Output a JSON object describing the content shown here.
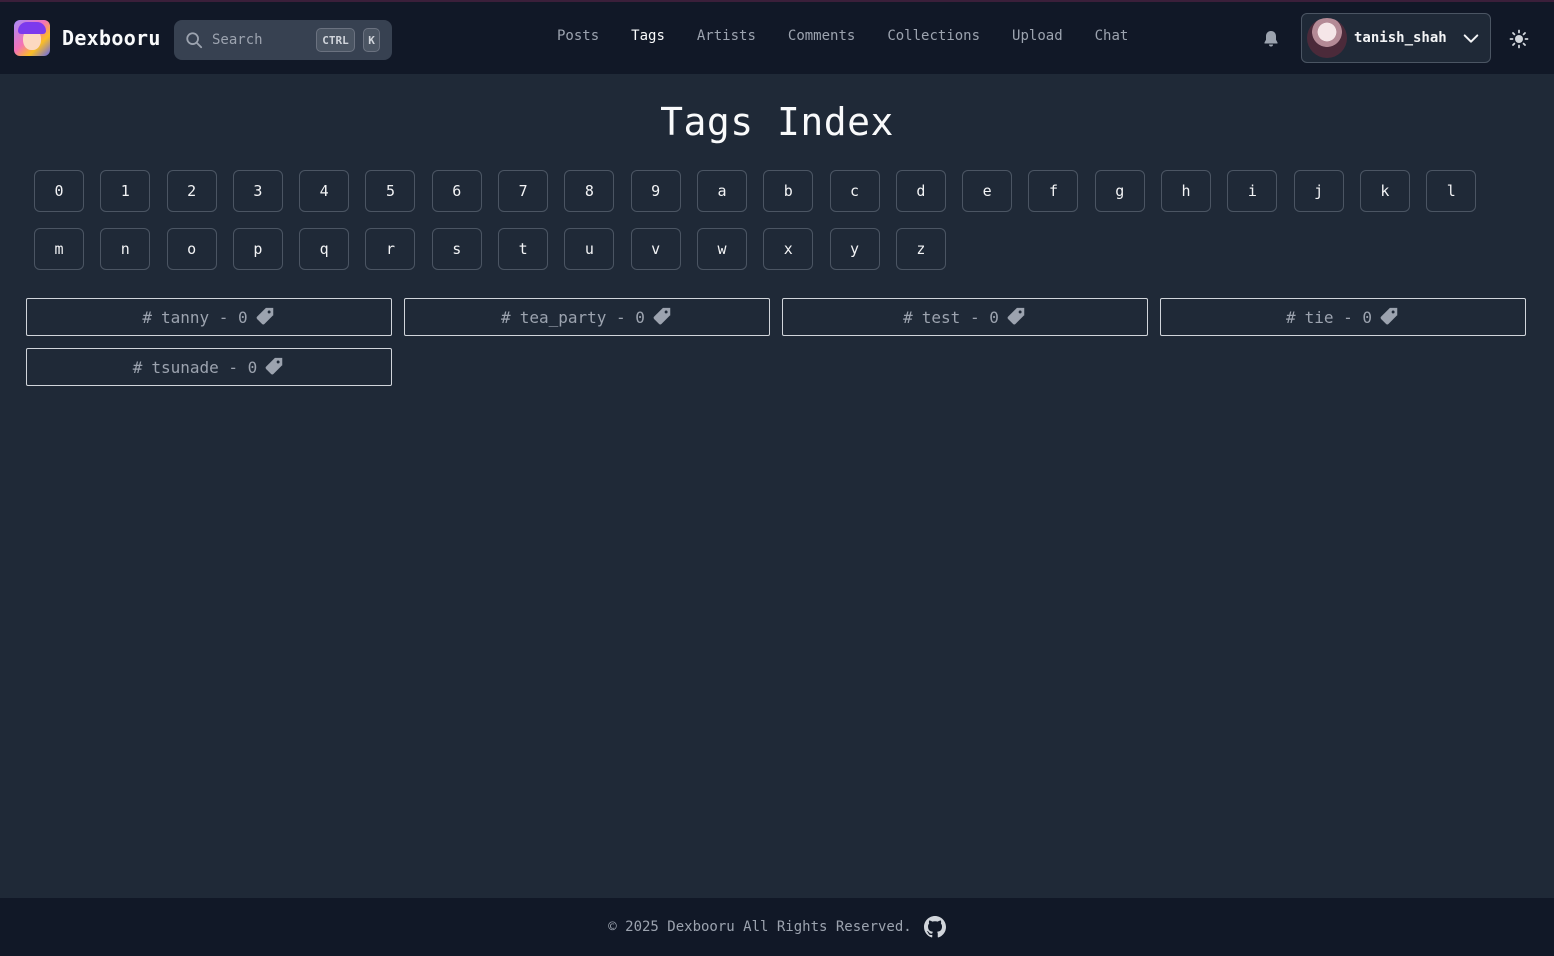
{
  "header": {
    "brand": "Dexbooru",
    "search": {
      "placeholder": "Search",
      "kbd_ctrl": "CTRL",
      "kbd_k": "K"
    },
    "nav": [
      {
        "label": "Posts",
        "active": false
      },
      {
        "label": "Tags",
        "active": true
      },
      {
        "label": "Artists",
        "active": false
      },
      {
        "label": "Comments",
        "active": false
      },
      {
        "label": "Collections",
        "active": false
      },
      {
        "label": "Upload",
        "active": false
      },
      {
        "label": "Chat",
        "active": false
      }
    ],
    "user": {
      "name": "tanish_shah"
    },
    "icons": [
      "search-icon",
      "bell-icon",
      "chevron-down-icon",
      "sun-icon"
    ]
  },
  "main": {
    "title": "Tags Index",
    "letters": [
      "0",
      "1",
      "2",
      "3",
      "4",
      "5",
      "6",
      "7",
      "8",
      "9",
      "a",
      "b",
      "c",
      "d",
      "e",
      "f",
      "g",
      "h",
      "i",
      "j",
      "k",
      "l",
      "m",
      "n",
      "o",
      "p",
      "q",
      "r",
      "s",
      "t",
      "u",
      "v",
      "w",
      "x",
      "y",
      "z"
    ],
    "tags": [
      {
        "name": "tanny",
        "count": "0"
      },
      {
        "name": "tea_party",
        "count": "0"
      },
      {
        "name": "test",
        "count": "0"
      },
      {
        "name": "tie",
        "count": "0"
      },
      {
        "name": "tsunade",
        "count": "0"
      }
    ]
  },
  "footer": {
    "text": "© 2025 Dexbooru All Rights Reserved."
  },
  "colors": {
    "background": "#1f2937",
    "header": "#111827",
    "border": "#4b5563",
    "muted_text": "#9ca3af"
  }
}
